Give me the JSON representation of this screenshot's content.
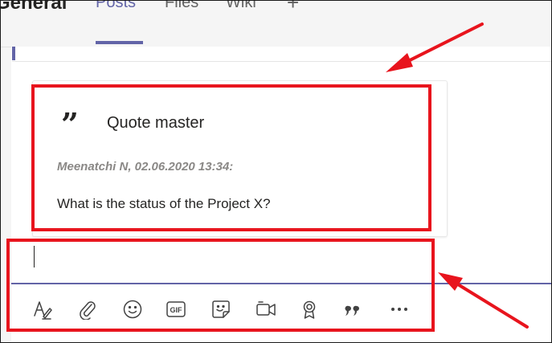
{
  "header": {
    "channel_title": "General",
    "tabs": [
      {
        "label": "Posts",
        "active": true
      },
      {
        "label": "Files",
        "active": false
      },
      {
        "label": "Wiki",
        "active": false
      }
    ],
    "add_tab_symbol": "+"
  },
  "quote": {
    "mark": "”",
    "title": "Quote master",
    "meta": "Meenatchi N, 02.06.2020 13:34:",
    "text": "What is the status of the Project X?"
  },
  "compose": {
    "value": "",
    "placeholder": ""
  },
  "toolbar": {
    "icons": [
      "format-icon",
      "attach-icon",
      "emoji-icon",
      "gif-icon",
      "sticker-icon",
      "meet-now-icon",
      "praise-icon",
      "quote-master-icon",
      "more-options-icon"
    ],
    "gif_label": "GIF",
    "more_label": "•••"
  },
  "colors": {
    "accent": "#6264a7",
    "annotation": "#e8141d",
    "text": "#252423",
    "muted": "#8a8886"
  }
}
